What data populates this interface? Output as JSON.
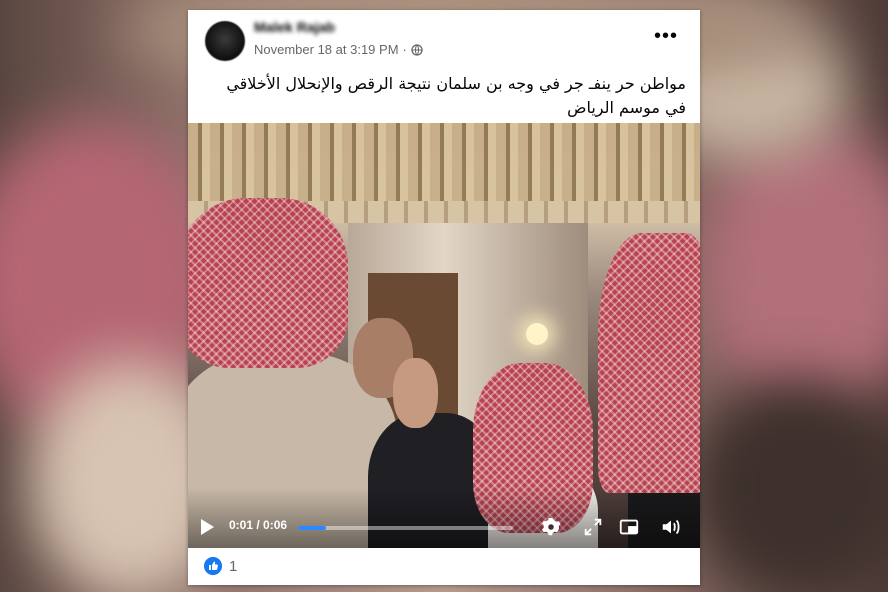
{
  "post": {
    "author": "Malek Rajab",
    "timestamp": "November 18 at 3:19 PM",
    "separator": "·",
    "more_label": "•••",
    "caption": "مواطن حر ينفـ جر في وجه بن سلمان نتيجة الرقص والإنحلال الأخلاقي في موسم الرياض"
  },
  "video": {
    "time_display": "0:01 / 0:06",
    "progress": 0.13,
    "accent_color": "#2d88ff"
  },
  "reactions": {
    "like_count": "1",
    "like_color": "#1877f2"
  },
  "icons": [
    "globe-icon",
    "more-icon",
    "play-icon",
    "settings-gear-icon",
    "fullscreen-icon",
    "picture-in-picture-icon",
    "volume-icon",
    "like-thumb-icon"
  ]
}
